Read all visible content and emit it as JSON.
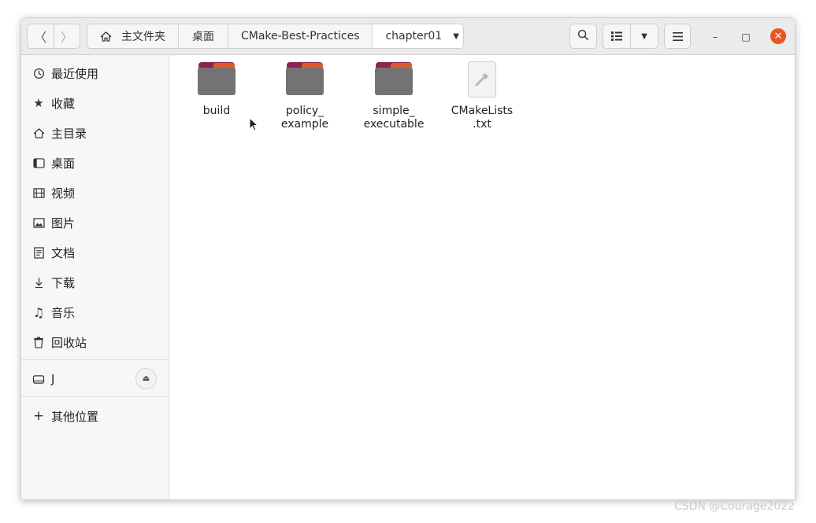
{
  "window": {
    "path": [
      "主文件夹",
      "桌面",
      "CMake-Best-Practices",
      "chapter01"
    ]
  },
  "header": {
    "back_label": "〈",
    "forward_label": "〉",
    "minimize_label": "–",
    "maximize_label": "□",
    "close_label": "✕"
  },
  "sidebar": {
    "places": [
      {
        "label": "最近使用",
        "icon": "clock-icon"
      },
      {
        "label": "收藏",
        "icon": "star-icon"
      },
      {
        "label": "主目录",
        "icon": "home-icon"
      },
      {
        "label": "桌面",
        "icon": "desktop-icon"
      },
      {
        "label": "视频",
        "icon": "video-icon"
      },
      {
        "label": "图片",
        "icon": "picture-icon"
      },
      {
        "label": "文档",
        "icon": "document-icon"
      },
      {
        "label": "下载",
        "icon": "download-icon"
      },
      {
        "label": "音乐",
        "icon": "music-icon"
      },
      {
        "label": "回收站",
        "icon": "trash-icon"
      }
    ],
    "drive": {
      "label": "J",
      "icon": "drive-icon"
    },
    "other": {
      "label": "其他位置",
      "icon": "plus-icon"
    }
  },
  "files": [
    {
      "name": "build",
      "type": "folder"
    },
    {
      "name": "policy_\nexample",
      "type": "folder"
    },
    {
      "name": "simple_\nexecutable",
      "type": "folder"
    },
    {
      "name": "CMakeLists\n.txt",
      "type": "text"
    }
  ],
  "colors": {
    "accent": "#e95420",
    "folder": "#737373",
    "folder_tab": "#8e2250"
  },
  "watermark": "CSDN @Courage2022"
}
